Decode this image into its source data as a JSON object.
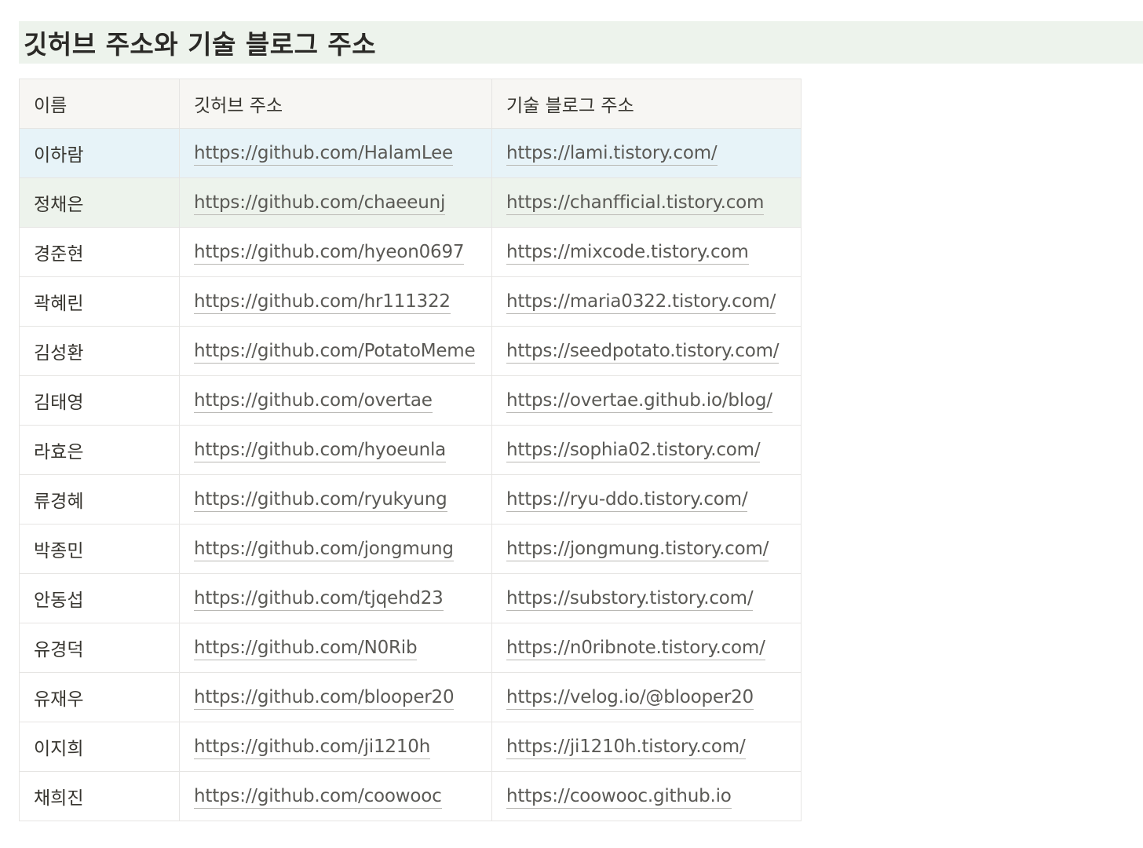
{
  "heading": "깃허브 주소와 기술 블로그 주소",
  "table": {
    "headers": [
      "이름",
      "깃허브 주소",
      "기술 블로그 주소"
    ],
    "rows": [
      {
        "name": "이하람",
        "github": "https://github.com/HalamLee",
        "blog": "https://lami.tistory.com/",
        "highlight": "blue"
      },
      {
        "name": "정채은",
        "github": "https://github.com/chaeeunj",
        "blog": "https://chanfficial.tistory.com",
        "highlight": "green"
      },
      {
        "name": "경준현",
        "github": "https://github.com/hyeon0697",
        "blog": "https://mixcode.tistory.com",
        "highlight": ""
      },
      {
        "name": "곽혜린",
        "github": "https://github.com/hr111322",
        "blog": "https://maria0322.tistory.com/",
        "highlight": ""
      },
      {
        "name": "김성환",
        "github": "https://github.com/PotatoMeme",
        "blog": "https://seedpotato.tistory.com/",
        "highlight": ""
      },
      {
        "name": "김태영",
        "github": "https://github.com/overtae",
        "blog": "https://overtae.github.io/blog/",
        "highlight": ""
      },
      {
        "name": "라효은",
        "github": "https://github.com/hyoeunla",
        "blog": "https://sophia02.tistory.com/",
        "highlight": ""
      },
      {
        "name": "류경혜",
        "github": "https://github.com/ryukyung",
        "blog": "https://ryu-ddo.tistory.com/",
        "highlight": ""
      },
      {
        "name": "박종민",
        "github": "https://github.com/jongmung",
        "blog": "https://jongmung.tistory.com/",
        "highlight": ""
      },
      {
        "name": "안동섭",
        "github": "https://github.com/tjqehd23",
        "blog": "https://substory.tistory.com/",
        "highlight": ""
      },
      {
        "name": "유경덕",
        "github": "https://github.com/N0Rib",
        "blog": "https://n0ribnote.tistory.com/",
        "highlight": ""
      },
      {
        "name": "유재우",
        "github": "https://github.com/blooper20",
        "blog": "https://velog.io/@blooper20",
        "highlight": ""
      },
      {
        "name": "이지희",
        "github": "https://github.com/ji1210h",
        "blog": "https://ji1210h.tistory.com/",
        "highlight": ""
      },
      {
        "name": "채희진",
        "github": "https://github.com/coowooc",
        "blog": "https://coowooc.github.io",
        "highlight": ""
      }
    ]
  },
  "colors": {
    "heading_bg": "#edf3ec",
    "header_row_bg": "#f7f6f3",
    "highlight_blue": "#e7f3f8",
    "highlight_green": "#edf3ec",
    "border": "#e6e5e3"
  }
}
